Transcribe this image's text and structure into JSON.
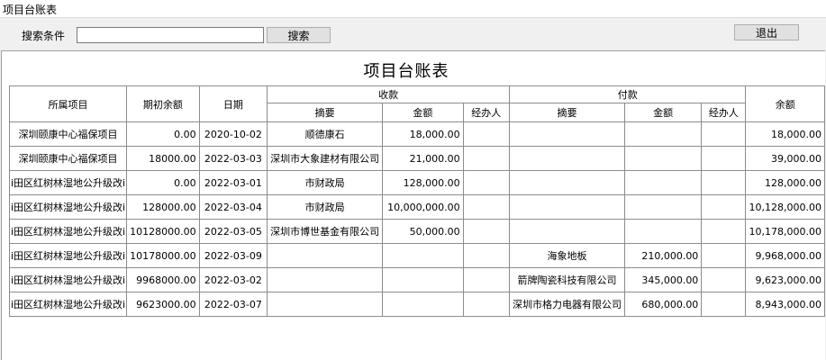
{
  "window": {
    "title": "项目台账表"
  },
  "toolbar": {
    "search_label": "搜索条件",
    "search_value": "",
    "search_button": "搜索",
    "exit_button": "退出"
  },
  "report": {
    "title": "项目台账表",
    "headers": {
      "project": "所属项目",
      "opening_balance": "期初余额",
      "date": "日期",
      "receipts": "收款",
      "payments": "付款",
      "balance": "余额",
      "summary": "摘要",
      "amount": "金额",
      "handler": "经办人"
    },
    "rows": [
      {
        "project": "深圳颐康中心福保项目",
        "opening": "0.00",
        "date": "2020-10-02",
        "in_summary": "顺德康石",
        "in_amount": "18,000.00",
        "in_handler": "",
        "out_summary": "",
        "out_amount": "",
        "out_handler": "",
        "balance": "18,000.00"
      },
      {
        "project": "深圳颐康中心福保项目",
        "opening": "18000.00",
        "date": "2022-03-03",
        "in_summary": "深圳市大象建材有限公司",
        "in_amount": "21,000.00",
        "in_handler": "",
        "out_summary": "",
        "out_amount": "",
        "out_handler": "",
        "balance": "39,000.00"
      },
      {
        "project": "i田区红树林湿地公升级改i",
        "opening": "0.00",
        "date": "2022-03-01",
        "in_summary": "市财政局",
        "in_amount": "128,000.00",
        "in_handler": "",
        "out_summary": "",
        "out_amount": "",
        "out_handler": "",
        "balance": "128,000.00"
      },
      {
        "project": "i田区红树林湿地公升级改i",
        "opening": "128000.00",
        "date": "2022-03-04",
        "in_summary": "市财政局",
        "in_amount": "10,000,000.00",
        "in_handler": "",
        "out_summary": "",
        "out_amount": "",
        "out_handler": "",
        "balance": "10,128,000.00"
      },
      {
        "project": "i田区红树林湿地公升级改i",
        "opening": "10128000.00",
        "date": "2022-03-05",
        "in_summary": "深圳市博世基金有限公司",
        "in_amount": "50,000.00",
        "in_handler": "",
        "out_summary": "",
        "out_amount": "",
        "out_handler": "",
        "balance": "10,178,000.00"
      },
      {
        "project": "i田区红树林湿地公升级改i",
        "opening": "10178000.00",
        "date": "2022-03-09",
        "in_summary": "",
        "in_amount": "",
        "in_handler": "",
        "out_summary": "海象地板",
        "out_amount": "210,000.00",
        "out_handler": "",
        "balance": "9,968,000.00"
      },
      {
        "project": "i田区红树林湿地公升级改i",
        "opening": "9968000.00",
        "date": "2022-03-02",
        "in_summary": "",
        "in_amount": "",
        "in_handler": "",
        "out_summary": "箭牌陶瓷科技有限公司",
        "out_amount": "345,000.00",
        "out_handler": "",
        "balance": "9,623,000.00"
      },
      {
        "project": "i田区红树林湿地公升级改i",
        "opening": "9623000.00",
        "date": "2022-03-07",
        "in_summary": "",
        "in_amount": "",
        "in_handler": "",
        "out_summary": "深圳市格力电器有限公司",
        "out_amount": "680,000.00",
        "out_handler": "",
        "balance": "8,943,000.00"
      }
    ]
  }
}
